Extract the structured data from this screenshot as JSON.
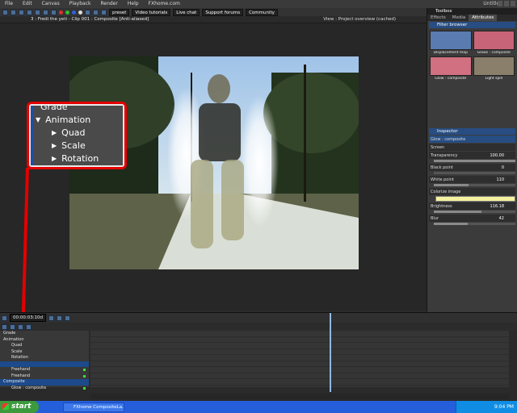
{
  "menubar": {
    "items": [
      "File",
      "Edit",
      "Canvas",
      "Playback",
      "Render",
      "Help",
      "FXhome.com"
    ],
    "doc_title": "Untitled"
  },
  "toolbar": {
    "links": [
      "preset",
      "Video tutorials",
      "Live chat",
      "Support forums",
      "Community"
    ]
  },
  "viewer": {
    "title": "3 : Fredi the yeti - Clip 001 : Composite [Anti-aliased]",
    "mode_label": "View :",
    "mode_value": "Project overview (cached)"
  },
  "zoom_callout": {
    "rows": [
      {
        "arrow": "",
        "label": "Grade"
      },
      {
        "arrow": "▼",
        "label": "Animation"
      },
      {
        "arrow": "▶",
        "label": "Quad"
      },
      {
        "arrow": "▶",
        "label": "Scale"
      },
      {
        "arrow": "▶",
        "label": "Rotation"
      }
    ],
    "highlight_color": "#e30000"
  },
  "right_panel": {
    "header": "Toolbox",
    "tabs": [
      "Effects",
      "Media",
      "Attributes"
    ],
    "filter_browser_title": "Filter browser",
    "thumbs": [
      {
        "label": "Displacement map",
        "color": "#5a7bb0"
      },
      {
        "label": "Glows : composite",
        "color": "#c86478"
      },
      {
        "label": "Glow : composite",
        "color": "#d07080"
      },
      {
        "label": "Light spill",
        "color": "#8a7f6a"
      }
    ],
    "inspector_title": "Inspector",
    "inspector_item": "Glow : composite",
    "rows": [
      {
        "label": "Screen",
        "value": "",
        "fill": 0
      },
      {
        "label": "Transparency",
        "value": "100.00",
        "fill": 1.0
      },
      {
        "label": "Black point",
        "value": "0",
        "fill": 0.0
      },
      {
        "label": "White point",
        "value": "110",
        "fill": 0.43
      },
      {
        "label": "Colorize image",
        "value": "",
        "fill": 0
      }
    ],
    "swatch_color": "#f5f2a0",
    "rows2": [
      {
        "label": "Brightness",
        "value": "116.18",
        "fill": 0.58
      },
      {
        "label": "Blur",
        "value": "42",
        "fill": 0.42
      }
    ]
  },
  "timeline": {
    "timecode": "00:00:03:10d",
    "tracks": [
      {
        "label": "Grade",
        "indent": 0,
        "sel": false,
        "mark": false
      },
      {
        "label": "Animation",
        "indent": 0,
        "sel": false,
        "mark": false
      },
      {
        "label": "Quad",
        "indent": 1,
        "sel": false,
        "mark": false
      },
      {
        "label": "Scale",
        "indent": 1,
        "sel": false,
        "mark": false
      },
      {
        "label": "Rotation",
        "indent": 1,
        "sel": false,
        "mark": false
      },
      {
        "label": "",
        "indent": 0,
        "sel": true,
        "mark": false
      },
      {
        "label": "Freehand",
        "indent": 1,
        "sel": false,
        "mark": true
      },
      {
        "label": "Freehand",
        "indent": 1,
        "sel": false,
        "mark": true
      },
      {
        "label": "Composite",
        "indent": 0,
        "sel": true,
        "mark": false
      },
      {
        "label": "Glow : composite",
        "indent": 1,
        "sel": false,
        "mark": true
      }
    ]
  },
  "taskbar": {
    "start_label": "start",
    "task_label": "FXhome CompositeLa...",
    "clock": "9:04 PM"
  }
}
